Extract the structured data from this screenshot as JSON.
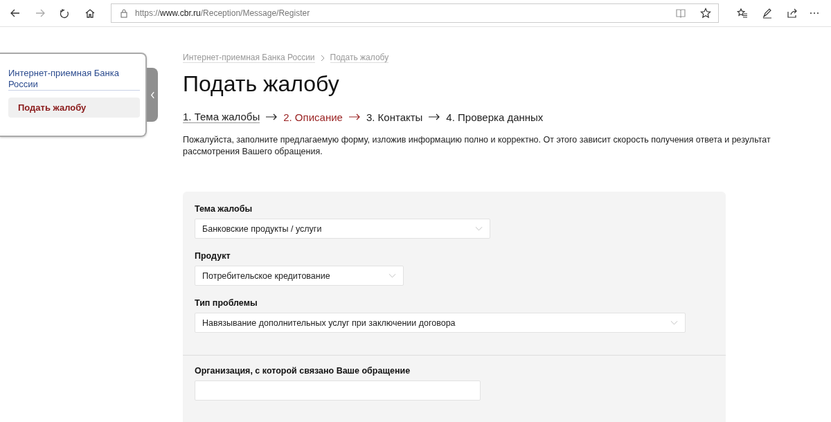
{
  "browser": {
    "url": {
      "scheme": "https://",
      "host": "www.cbr.ru",
      "path": "/Reception/Message/Register"
    }
  },
  "sidebar": {
    "link": "Интернет-приемная Банка России",
    "items": [
      {
        "label": "Подать жалобу",
        "selected": true
      }
    ]
  },
  "breadcrumbs": [
    "Интернет-приемная Банка России",
    "Подать жалобу"
  ],
  "title": "Подать жалобу",
  "steps": [
    {
      "label": "1. Тема жалобы",
      "selected": false,
      "done": true
    },
    {
      "label": "2. Описание",
      "selected": true,
      "done": false
    },
    {
      "label": "3. Контакты",
      "selected": false,
      "done": false
    },
    {
      "label": "4. Проверка данных",
      "selected": false,
      "done": false
    }
  ],
  "intro": "Пожалуйста, заполните предлагаемую форму, изложив информацию полно и корректно. От этого зависит скорость получения ответа и результат рассмотрения Вашего обращения.",
  "form": {
    "sections": [
      {
        "fields": [
          {
            "kind": "select",
            "label": "Тема жалобы",
            "value": "Банковские продукты / услуги"
          },
          {
            "kind": "select",
            "label": "Продукт",
            "value": "Потребительское кредитование"
          },
          {
            "kind": "select",
            "label": "Тип проблемы",
            "value": "Навязывание дополнительных услуг при заключении договора"
          }
        ]
      },
      {
        "fields": [
          {
            "kind": "text",
            "label": "Организация, с которой связано Ваше обращение"
          }
        ]
      }
    ]
  }
}
